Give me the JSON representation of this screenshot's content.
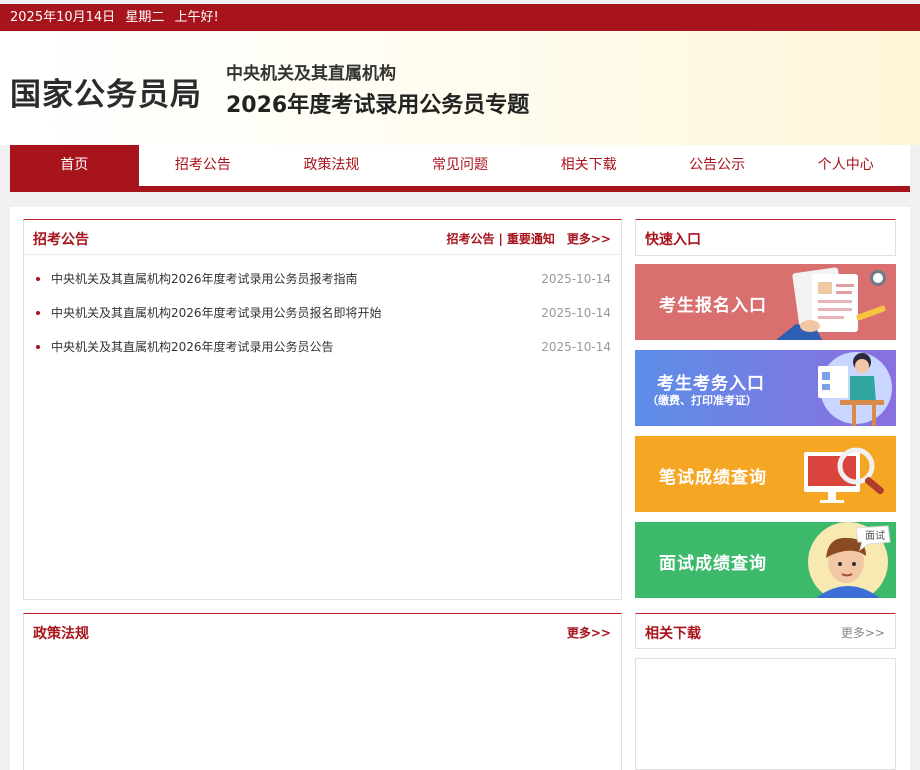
{
  "topbar": {
    "date": "2025年10月14日",
    "weekday": "星期二",
    "greeting": "上午好!"
  },
  "header": {
    "site_name": "国家公务员局",
    "subtitle1": "中央机关及其直属机构",
    "subtitle2": "2026年度考试录用公务员专题"
  },
  "nav": {
    "items": [
      "首页",
      "招考公告",
      "政策法规",
      "常见问题",
      "相关下载",
      "公告公示",
      "个人中心"
    ]
  },
  "announcements": {
    "title": "招考公告",
    "link1": "招考公告",
    "separator": "|",
    "link2": "重要通知",
    "more": "更多>>",
    "items": [
      {
        "title": "中央机关及其直属机构2026年度考试录用公务员报考指南",
        "date": "2025-10-14"
      },
      {
        "title": "中央机关及其直属机构2026年度考试录用公务员报名即将开始",
        "date": "2025-10-14"
      },
      {
        "title": "中央机关及其直属机构2026年度考试录用公务员公告",
        "date": "2025-10-14"
      }
    ]
  },
  "quick": {
    "title": "快速入口",
    "entries": [
      {
        "label": "考生报名入口",
        "color": "#d96f6f"
      },
      {
        "label": "考生考务入口",
        "sub": "（缴费、打印准考证）",
        "color": "#6b82e0"
      },
      {
        "label": "笔试成绩查询",
        "color": "#f5a623"
      },
      {
        "label": "面试成绩查询",
        "badge": "面试",
        "color": "#3cb96a"
      }
    ]
  },
  "policy": {
    "title": "政策法规",
    "more": "更多>>"
  },
  "downloads": {
    "title": "相关下载",
    "more": "更多>>"
  },
  "colors": {
    "brand_red": "#a8141c"
  }
}
